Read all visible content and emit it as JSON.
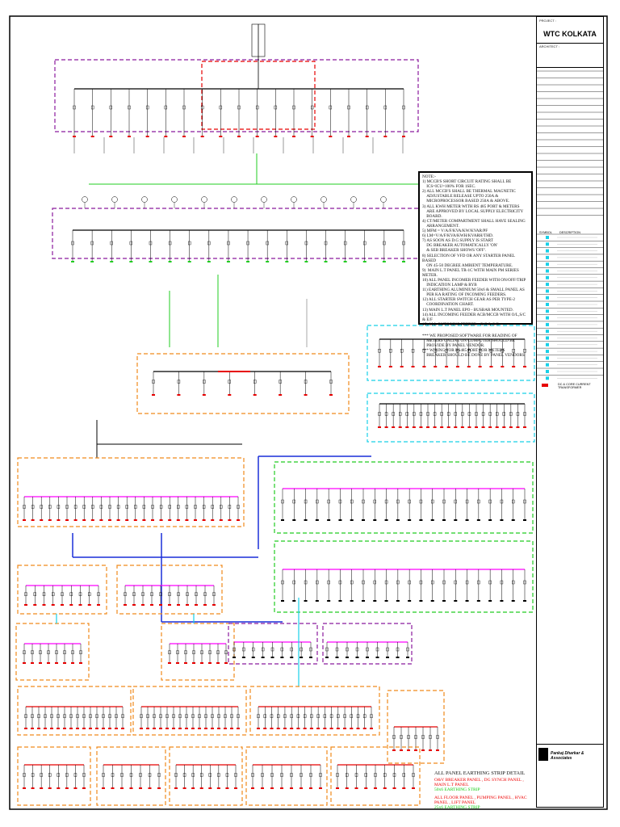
{
  "title_block": {
    "project_label": "PROJECT :",
    "project_name": "WTC KOLKATA",
    "architect_label": "ARCHITECT :",
    "legend_symbol_header": "SYMBOL",
    "legend_description_header": "DESCRIPTION",
    "legend_last_item": "DC & CORE CURRENT TRANSFORMER",
    "consultant": "Pankaj Dharkar & Associates"
  },
  "notes": {
    "heading": "NOTE:-",
    "items": [
      "1) MCCB'S SHORT CIRCUIT RATING SHALL BE\n    ICS=ICU=100% FOR 1SEC.",
      "2) ALL MCCB'S SHALL BE THERMAL MAGNETIC\n    ADJUSTABLE RELEASE UPTO 250A &\n    MICROPROCESSOR BASED 250A & ABOVE.",
      "3) ALL KWH METER WITH RS 485 PORT & METERS\n    ARE APPROVED BY LOCAL SUPPLY ELECTRICITY\n    BOARD.",
      "4) CT/METER COMPARTMENT SHALL HAVE SEALING\n    ARRANGEMENT.",
      "5) MFM = V/A/F/KVA/KW/KVAR/PF",
      "6) LM=V/A/F/KVA/KWH/KVARH/THD.",
      "7) AS SOON AS D.G SUPPLY IS START\n    DG BREAKER AUTOMATICALLY 'ON'\n    & SEB BREAKER SHOWS 'OFF'.",
      "8) SELECTION OF VFD OR ANY STARTER PANEL BASED\n    ON 45-50 DEGREE AMBIENT TEMPERATURE.",
      "9)  MAIN L.T PANEL TR-1C WITH MAIN PM SERIES METER.",
      "10) ALL PANEL INCOMER FEEDER WITH ON/OFF/TRIP\n    INDICATION LAMP & RYB",
      "11) EARTHING ALUMINIUM 50x6 & SMALL PANEL AS\n    PER KA RATING OF INCOMING FEEDERS.",
      "12) ALL STARTER SWITCH GEAR AS PER TYPE-2\n    COORDINATION CHART.",
      "13) MAIN L.T PANEL EPO - BUSBAR MOUNTED.",
      "14) ALL INCOMING FEEDER ACB/MCCB WITH O/L,S/C & E/F",
      "15) ALL OUTGOING FEEDER - O/C & S/C"
    ],
    "footer": [
      "*** WE PROPOSED SOFTWARE FOR READING OF\n    METERS ONLINE ON COMPUTER SHOULD BE\n    PROVIDE BY PANEL VENDOR.",
      "*** WIRING FOR RS485 PORT FOR METERS\n    BREAKER SHOULD BE DONE BY PANEL VENDORS"
    ]
  },
  "earthing": {
    "title": "ALL PANEL EARTHING STRIP DETAIL",
    "group1": "O&V BREAKER PANEL , DG SYNCH PANEL , MAIN L.T PANEL",
    "group1_strip": "50x6 EARTHING STRIP",
    "group2": "ALL FLOOR PANEL , PUMPING PANEL , HVAC PANEL , LIFT PANEL",
    "group2_strip": "25x6 EARTHING STRIP"
  },
  "colors": {
    "purple": "#8b1a9e",
    "red": "#e60000",
    "green": "#22cc22",
    "orange": "#f08a1c",
    "cyan": "#18d0e8",
    "blue": "#1a2fd8",
    "magenta": "#ff00ff"
  }
}
